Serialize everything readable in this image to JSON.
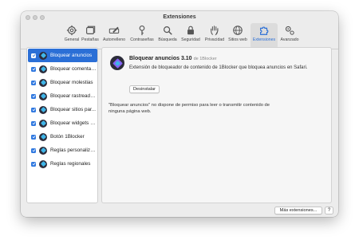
{
  "window": {
    "title": "Extensiones"
  },
  "toolbar": {
    "items": [
      {
        "label": "General",
        "icon": "gear-icon"
      },
      {
        "label": "Pestañas",
        "icon": "tabs-icon"
      },
      {
        "label": "Autorrelleno",
        "icon": "pencil-field-icon"
      },
      {
        "label": "Contraseñas",
        "icon": "key-icon"
      },
      {
        "label": "Búsqueda",
        "icon": "magnifier-icon"
      },
      {
        "label": "Seguridad",
        "icon": "lock-icon"
      },
      {
        "label": "Privacidad",
        "icon": "hand-icon"
      },
      {
        "label": "Sitios web",
        "icon": "globe-icon"
      },
      {
        "label": "Extensiones",
        "icon": "puzzle-icon"
      },
      {
        "label": "Avanzado",
        "icon": "gears-icon"
      }
    ],
    "active": "Extensiones",
    "accent_color": "#2b6fd6"
  },
  "sidebar": {
    "items": [
      {
        "label": "Bloquear anuncios",
        "checked": true,
        "selected": true
      },
      {
        "label": "Bloquear comentari...",
        "checked": true
      },
      {
        "label": "Bloquear molestias",
        "checked": true
      },
      {
        "label": "Bloquear rastreado...",
        "checked": true
      },
      {
        "label": "Bloquear sitios par...",
        "checked": true
      },
      {
        "label": "Bloquear widgets d...",
        "checked": true
      },
      {
        "label": "Botón 1Blocker",
        "checked": true
      },
      {
        "label": "Reglas personaliza...",
        "checked": true
      },
      {
        "label": "Reglas regionales",
        "checked": true
      }
    ]
  },
  "detail": {
    "name": "Bloquear anuncios 3.10",
    "developer": "de 1Blocker",
    "description": "Extensión de bloqueador de contenido de 1Blocker que bloquea anuncios en Safari.",
    "uninstall_label": "Desinstalar",
    "permission_text_line1": "\"Bloquear anuncios\" no dispone de permiso para leer o transmitir contenido de",
    "permission_text_line2": "ninguna página web."
  },
  "footer": {
    "more_extensions_label": "Más extensiones...",
    "help_label": "?"
  }
}
